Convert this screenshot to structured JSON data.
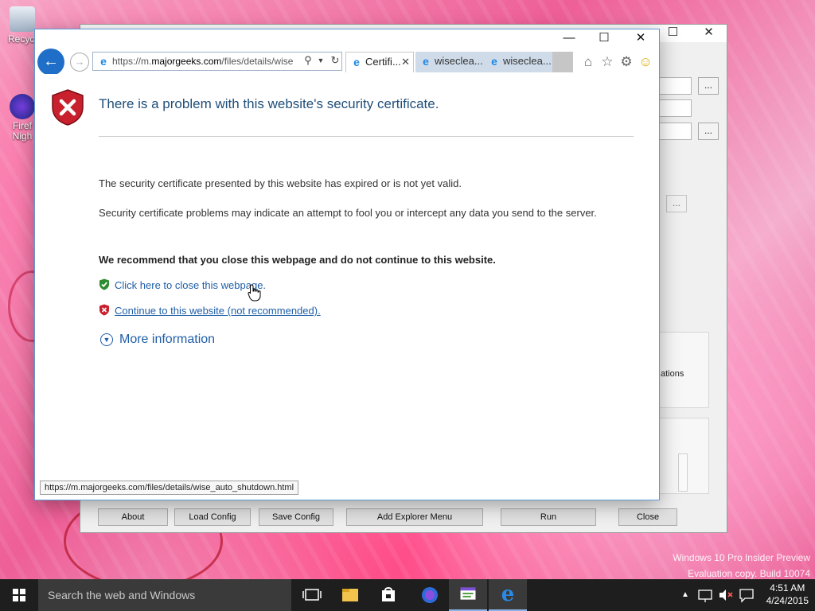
{
  "desktop": {
    "icons": [
      {
        "label": "Recycl"
      },
      {
        "label": "Firef\nNigh"
      }
    ],
    "watermark": {
      "line1": "Windows 10 Pro Insider Preview",
      "line2": "Evaluation copy. Build 10074"
    }
  },
  "background_app": {
    "dots": "...",
    "group_text": "ations",
    "buttons": {
      "about": "About",
      "load_config": "Load Config",
      "save_config": "Save Config",
      "add_explorer_menu": "Add Explorer Menu",
      "run": "Run",
      "close": "Close"
    }
  },
  "browser": {
    "address": {
      "scheme": "https://m.",
      "host": "majorgeeks.com",
      "path": "/files/details/wise"
    },
    "tabs": [
      {
        "label": "Certifi..."
      },
      {
        "label": "wisecl​ea..."
      },
      {
        "label": "wisecl​ea..."
      }
    ],
    "page": {
      "title": "There is a problem with this website's security certificate.",
      "para1": "The security certificate presented by this website has expired or is not yet valid.",
      "para2": "Security certificate problems may indicate an attempt to fool you or intercept any data you send to the server.",
      "recommend": "We recommend that you close this webpage and do not continue to this website.",
      "close_link": "Click here to close this webpage.",
      "continue_link": "Continue to this website (not recommended).",
      "more_info": "More information"
    },
    "status_url": "https://m.majorgeeks.com/files/details/wise_auto_shutdown.html"
  },
  "taskbar": {
    "search_placeholder": "Search the web and Windows",
    "time": "4:51 AM",
    "date": "4/24/2015"
  },
  "colors": {
    "ie_blue": "#1f6fc9",
    "link_blue": "#1f5ea8",
    "title_blue": "#1f4e79",
    "shield_red": "#c8202c",
    "shield_green": "#2e8b2e"
  }
}
